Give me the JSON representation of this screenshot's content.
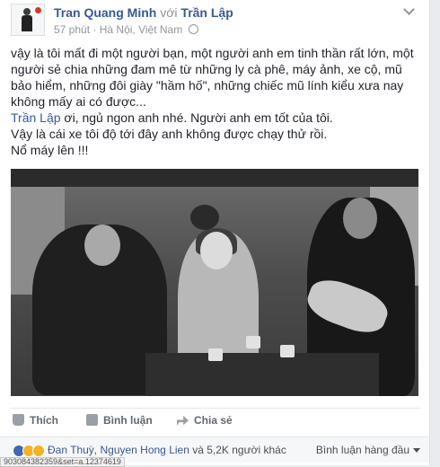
{
  "post": {
    "author": "Tran Quang Minh",
    "with_word": "với",
    "tagged": "Trần Lập",
    "time": "57 phút",
    "location": "Hà Nội, Việt Nam",
    "text_lines": [
      "vậy là tôi mất đi một người bạn, một người anh em tinh thần rất lớn, một",
      "người sẻ chia những đam mê từ những ly cà phê, máy ảnh, xe cộ, mũ",
      "bảo hiểm, những đôi giày \"hầm hố\", những chiếc mũ lính kiểu xưa nay",
      "không mấy ai có được..."
    ],
    "tag_name": "Trần Lập",
    "line2_rest": " ơi, ngủ ngon anh nhé. Người anh em tốt của tôi.",
    "line3": "Vậy là cái xe tôi độ tới đây anh không được chạy thử rồi.",
    "line4": "Nổ máy lên !!!"
  },
  "actions": {
    "like": "Thích",
    "comment": "Bình luận",
    "share": "Chia sẻ"
  },
  "reactions": {
    "names": "Đan Thuỳ, Nguyen Hong Lien",
    "rest": " và 5,2K người khác",
    "sort_label": "Bình luận hàng đầu"
  },
  "status_url": "903084382359&set=a.12374619",
  "colors": {
    "link": "#385898",
    "muted": "#90949c",
    "background": "#e9ebee"
  }
}
